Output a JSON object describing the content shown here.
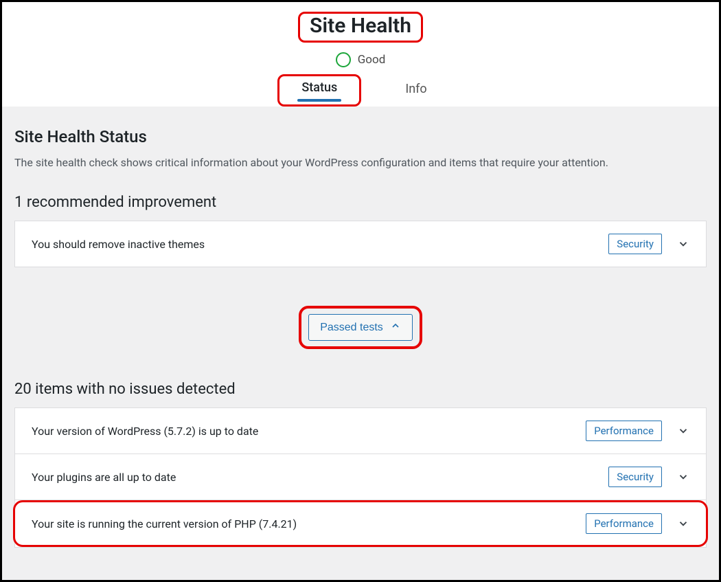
{
  "header": {
    "title": "Site Health",
    "status_label": "Good"
  },
  "tabs": {
    "active": "Status",
    "inactive": "Info"
  },
  "status_section": {
    "heading": "Site Health Status",
    "description": "The site health check shows critical information about your WordPress configuration and items that require your attention."
  },
  "recommended": {
    "heading": "1 recommended improvement",
    "items": [
      {
        "label": "You should remove inactive themes",
        "badge": "Security"
      }
    ]
  },
  "passed_toggle": {
    "label": "Passed tests"
  },
  "passed": {
    "heading": "20 items with no issues detected",
    "items": [
      {
        "label": "Your version of WordPress (5.7.2) is up to date",
        "badge": "Performance"
      },
      {
        "label": "Your plugins are all up to date",
        "badge": "Security"
      },
      {
        "label": "Your site is running the current version of PHP (7.4.21)",
        "badge": "Performance"
      }
    ]
  }
}
